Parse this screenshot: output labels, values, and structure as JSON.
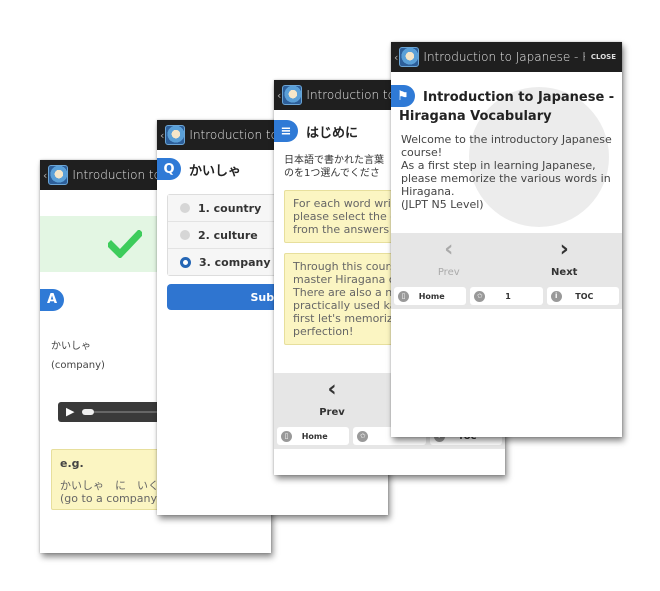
{
  "app": {
    "title_truncated": "Introduction to J",
    "title_full": "Introduction to Japanese - H.",
    "back_glyph": "‹",
    "close_label": "CLOSE"
  },
  "cards": {
    "answer": {
      "badge": "A",
      "word": "かいしゃ",
      "meaning": "(company)",
      "audio": {
        "play_glyph": "▶",
        "progress_percent": 0
      },
      "example": {
        "label": "e.g.",
        "sentence": "かいしゃ　に　いく",
        "translation": "(go to a company)"
      },
      "result": "correct"
    },
    "question": {
      "badge": "Q",
      "prompt": "かいしゃ",
      "choices": [
        {
          "label": "1. country",
          "selected": false
        },
        {
          "label": "2. culture",
          "selected": false
        },
        {
          "label": "3. company",
          "selected": true
        }
      ],
      "submit_label": "Submit"
    },
    "intro": {
      "heading": "はじめに",
      "instruction_jp_line1": "日本語で書かれた言葉",
      "instruction_jp_line2": "のを1つ選んでくださ",
      "note1": [
        "For each word writ",
        "please select the c",
        "from the answers p"
      ],
      "note2": [
        "Through this cours",
        "master Hiragana c",
        "There are also a nu",
        "practically used ka",
        "first let's memorize",
        "perfection!"
      ],
      "nav": {
        "prev": "Prev",
        "home": "Home",
        "toc": "TOC"
      }
    },
    "cover": {
      "title": "Introduction to Japanese - Hiragana Vocabulary",
      "body": [
        "Welcome to the introductory Japanese course!",
        "As a first step in learning Japanese, please memorize the various words in Hiragana.",
        "(JLPT N5 Level)"
      ],
      "nav": {
        "prev": "Prev",
        "next": "Next",
        "home": "Home",
        "bookmark_count": "1",
        "toc": "TOC"
      }
    }
  },
  "colors": {
    "accent": "#2f7ad6",
    "note_bg": "#fbf5c2",
    "success_bg": "#e3f6e3",
    "check": "#3dcc5b",
    "titlebar": "#1f1f1f"
  }
}
